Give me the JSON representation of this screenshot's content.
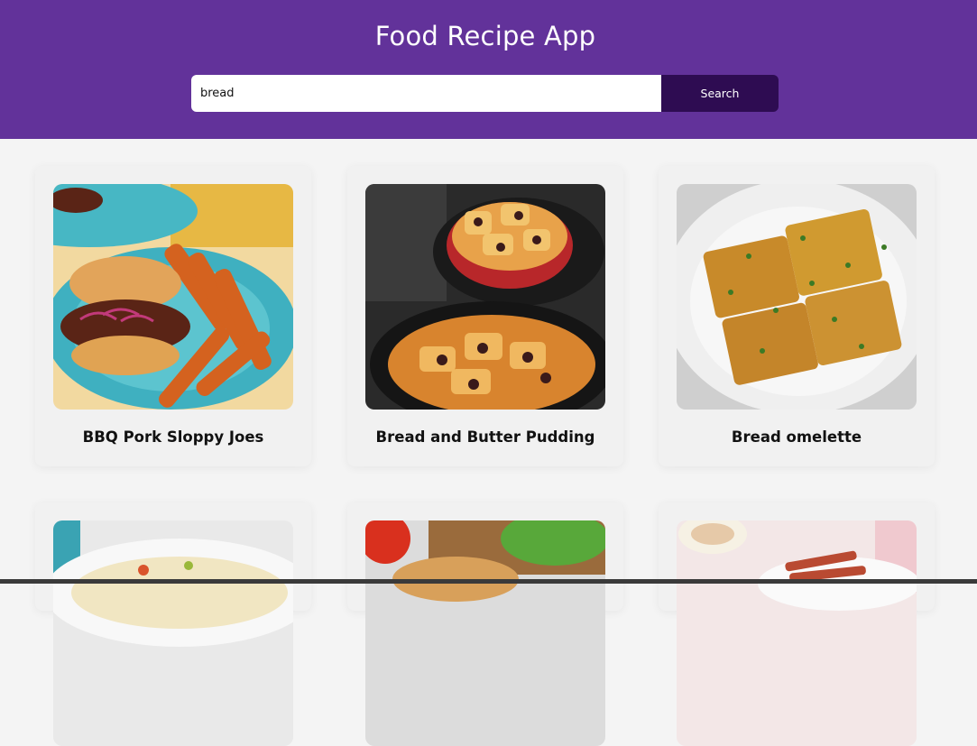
{
  "header": {
    "title": "Food Recipe App",
    "background": "#62329a"
  },
  "search": {
    "value": "bread",
    "placeholder": "",
    "button_label": "Search",
    "button_color": "#2e0c52"
  },
  "meals": [
    {
      "name": "BBQ Pork Sloppy Joes",
      "image": "bbq-pork-sloppy-joes-photo"
    },
    {
      "name": "Bread and Butter Pudding",
      "image": "bread-and-butter-pudding-photo"
    },
    {
      "name": "Bread omelette",
      "image": "bread-omelette-photo"
    },
    {
      "name": "",
      "image": "pasta-salad-photo"
    },
    {
      "name": "",
      "image": "sandwich-roll-photo"
    },
    {
      "name": "",
      "image": "bacon-breakfast-photo"
    }
  ]
}
